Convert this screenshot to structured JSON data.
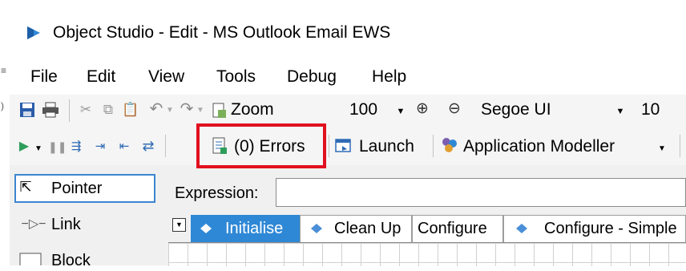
{
  "window": {
    "title": "Object Studio  - Edit - MS Outlook Email EWS",
    "icon": "object-studio-icon"
  },
  "menu": [
    "File",
    "Edit",
    "View",
    "Tools",
    "Debug",
    "Help"
  ],
  "toolbar1": {
    "zoom_label": "Zoom",
    "zoom_value": "100",
    "font_name": "Segoe UI",
    "font_size": "10"
  },
  "toolbar2": {
    "errors_label": "(0) Errors",
    "launch_label": "Launch",
    "app_modeller_label": "Application Modeller"
  },
  "palette": {
    "items": [
      "Pointer",
      "Link",
      "Block"
    ]
  },
  "expression": {
    "label": "Expression:",
    "value": ""
  },
  "tabs": [
    "Initialise",
    "Clean Up",
    "Configure",
    "Configure - Simple"
  ],
  "colors": {
    "highlight": "#e1101e",
    "active_tab": "#2f88d6",
    "run_green": "#2e9e5b",
    "selected_border": "#3b86d1"
  }
}
